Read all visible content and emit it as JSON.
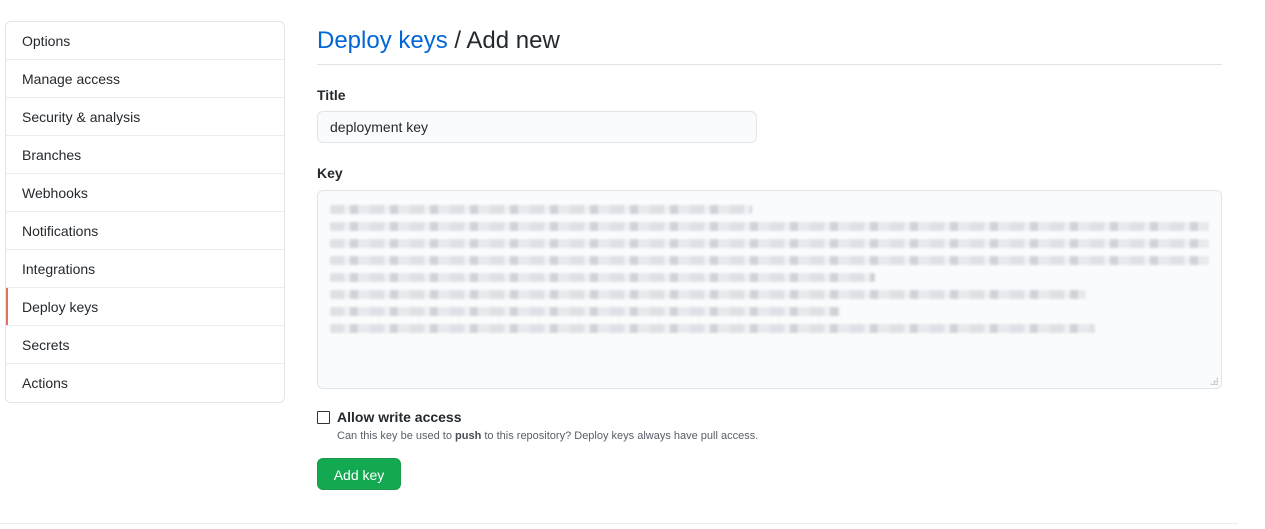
{
  "sidebar": {
    "items": [
      {
        "label": "Options"
      },
      {
        "label": "Manage access"
      },
      {
        "label": "Security & analysis"
      },
      {
        "label": "Branches"
      },
      {
        "label": "Webhooks"
      },
      {
        "label": "Notifications"
      },
      {
        "label": "Integrations"
      },
      {
        "label": "Deploy keys",
        "selected": true
      },
      {
        "label": "Secrets"
      },
      {
        "label": "Actions"
      }
    ],
    "selected_accent": "#e36f5f"
  },
  "header": {
    "breadcrumb_link": "Deploy keys",
    "separator": "/",
    "title": "Add new"
  },
  "form": {
    "title_label": "Title",
    "title_value": "deployment key",
    "key_label": "Key",
    "key_value": "[redacted / blurred SSH public key]",
    "allow_write_label": "Allow write access",
    "allow_write_checked": false,
    "note_prefix": "Can this key be used to",
    "note_bold": "push",
    "note_suffix": "to this repository? Deploy keys always have pull access.",
    "submit_label": "Add key"
  },
  "colors": {
    "link": "#0366d6",
    "button": "#13a950"
  }
}
